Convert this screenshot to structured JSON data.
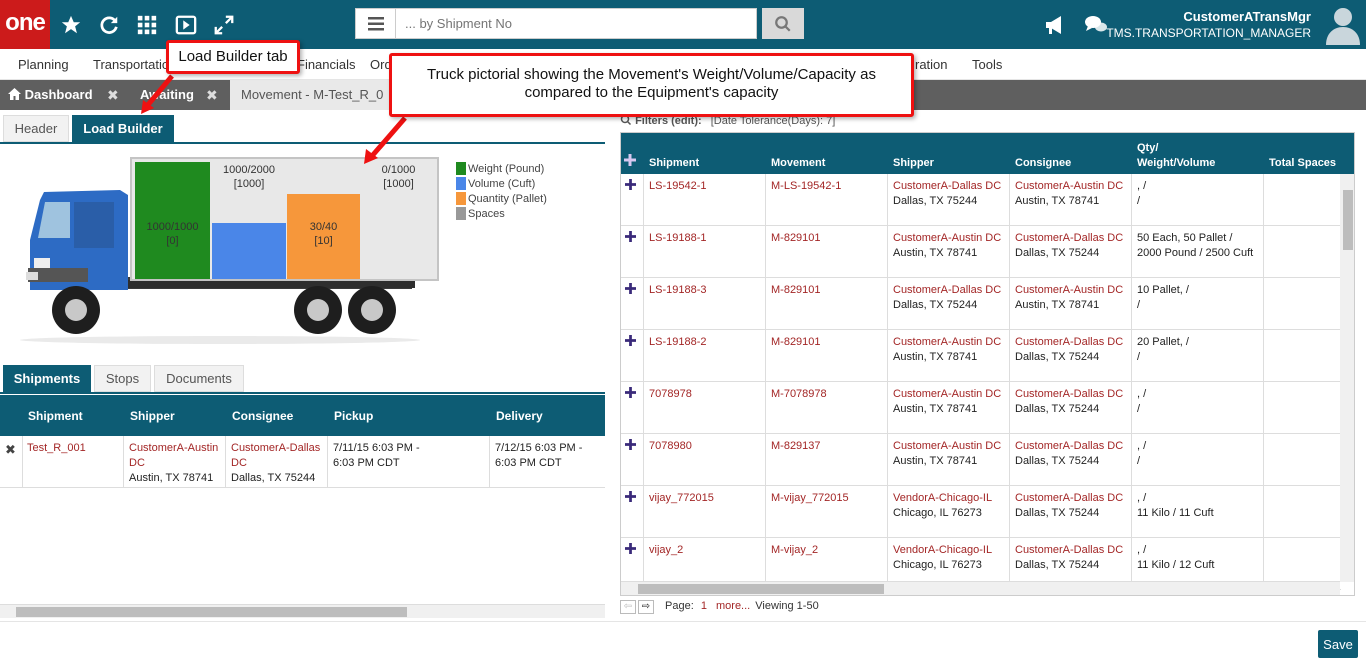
{
  "header": {
    "logo": "one",
    "search_placeholder": "... by Shipment No",
    "user_name": "CustomerATransMgr",
    "user_role": "TMS.TRANSPORTATION_MANAGER"
  },
  "menu": {
    "items": [
      "Planning",
      "Transportation",
      "Financials",
      "Ord",
      "ration",
      "Tools"
    ]
  },
  "tabs": {
    "dashboard": "Dashboard",
    "awaiting": "Awaiting",
    "movement": "Movement - M-Test_R_0"
  },
  "subtabs": {
    "header": "Header",
    "load_builder": "Load Builder"
  },
  "truck": {
    "weight_label": "1000/1000",
    "weight_sub": "[0]",
    "weight_fill": 1.0,
    "volume_label": "1000/2000",
    "volume_sub": "[1000]",
    "volume_fill": 0.5,
    "quantity_label": "30/40",
    "quantity_sub": "[10]",
    "quantity_fill": 0.75,
    "spaces_label": "0/1000",
    "spaces_sub": "[1000]",
    "spaces_fill": 0.0,
    "colors": {
      "weight": "#1f8a1f",
      "volume": "#4a86e8",
      "quantity": "#f6973b",
      "spaces": "#999999"
    }
  },
  "legend": [
    "Weight (Pound)",
    "Volume (Cuft)",
    "Quantity (Pallet)",
    "Spaces"
  ],
  "lower_tabs": {
    "shipments": "Shipments",
    "stops": "Stops",
    "documents": "Documents"
  },
  "left_table": {
    "columns": [
      "Shipment",
      "Shipper",
      "Consignee",
      "Pickup",
      "Delivery"
    ],
    "row": {
      "shipment": "Test_R_001",
      "shipper_name": "CustomerA-Austin DC",
      "shipper_addr": "Austin, TX 78741",
      "consignee_name": "CustomerA-Dallas DC",
      "consignee_addr": "Dallas, TX 75244",
      "pickup": "7/11/15 6:03 PM - 6:03 PM CDT",
      "delivery": "7/12/15 6:03 PM - 6:03 PM CDT"
    }
  },
  "filters": {
    "label": "Filters (edit):",
    "value": "[Date Tolerance(Days): 7]"
  },
  "right_table": {
    "columns": [
      "Shipment",
      "Movement",
      "Shipper",
      "Consignee",
      "Qty/",
      "Weight/Volume",
      "Total Spaces"
    ],
    "rows": [
      {
        "shipment": "LS-19542-1",
        "movement": "M-LS-19542-1",
        "shipper": "CustomerA-Dallas DC",
        "shipper_addr": "Dallas, TX 75244",
        "consignee": "CustomerA-Austin DC",
        "consignee_addr": "Austin, TX 78741",
        "qty1": ", /",
        "qty2": "/"
      },
      {
        "shipment": "LS-19188-1",
        "movement": "M-829101",
        "shipper": "CustomerA-Austin DC",
        "shipper_addr": "Austin, TX 78741",
        "consignee": "CustomerA-Dallas DC",
        "consignee_addr": "Dallas, TX 75244",
        "qty1": "50 Each, 50 Pallet /",
        "qty2": "2000 Pound / 2500 Cuft"
      },
      {
        "shipment": "LS-19188-3",
        "movement": "M-829101",
        "shipper": "CustomerA-Dallas DC",
        "shipper_addr": "Dallas, TX 75244",
        "consignee": "CustomerA-Austin DC",
        "consignee_addr": "Austin, TX 78741",
        "qty1": "10 Pallet, /",
        "qty2": "/"
      },
      {
        "shipment": "LS-19188-2",
        "movement": "M-829101",
        "shipper": "CustomerA-Austin DC",
        "shipper_addr": "Austin, TX 78741",
        "consignee": "CustomerA-Dallas DC",
        "consignee_addr": "Dallas, TX 75244",
        "qty1": "20 Pallet, /",
        "qty2": "/"
      },
      {
        "shipment": "7078978",
        "movement": "M-7078978",
        "shipper": "CustomerA-Austin DC",
        "shipper_addr": "Austin, TX 78741",
        "consignee": "CustomerA-Dallas DC",
        "consignee_addr": "Dallas, TX 75244",
        "qty1": ", /",
        "qty2": "/"
      },
      {
        "shipment": "7078980",
        "movement": "M-829137",
        "shipper": "CustomerA-Austin DC",
        "shipper_addr": "Austin, TX 78741",
        "consignee": "CustomerA-Dallas DC",
        "consignee_addr": "Dallas, TX 75244",
        "qty1": ", /",
        "qty2": "/"
      },
      {
        "shipment": "vijay_772015",
        "movement": "M-vijay_772015",
        "shipper": "VendorA-Chicago-IL",
        "shipper_addr": "Chicago, IL 76273",
        "consignee": "CustomerA-Dallas DC",
        "consignee_addr": "Dallas, TX 75244",
        "qty1": ", /",
        "qty2": "11 Kilo / 11 Cuft"
      },
      {
        "shipment": "vijay_2",
        "movement": "M-vijay_2",
        "shipper": "VendorA-Chicago-IL",
        "shipper_addr": "Chicago, IL 76273",
        "consignee": "CustomerA-Dallas DC",
        "consignee_addr": "Dallas, TX 75244",
        "qty1": ", /",
        "qty2": "11 Kilo / 12 Cuft"
      }
    ]
  },
  "pager": {
    "page_label": "Page:",
    "page": "1",
    "more": "more...",
    "viewing": "Viewing 1-50"
  },
  "save_label": "Save",
  "callouts": {
    "load_builder_tab": "Load Builder tab",
    "truck_pictorial": "Truck pictorial showing the Movement's Weight/Volume/Capacity as compared to the Equipment's capacity"
  }
}
